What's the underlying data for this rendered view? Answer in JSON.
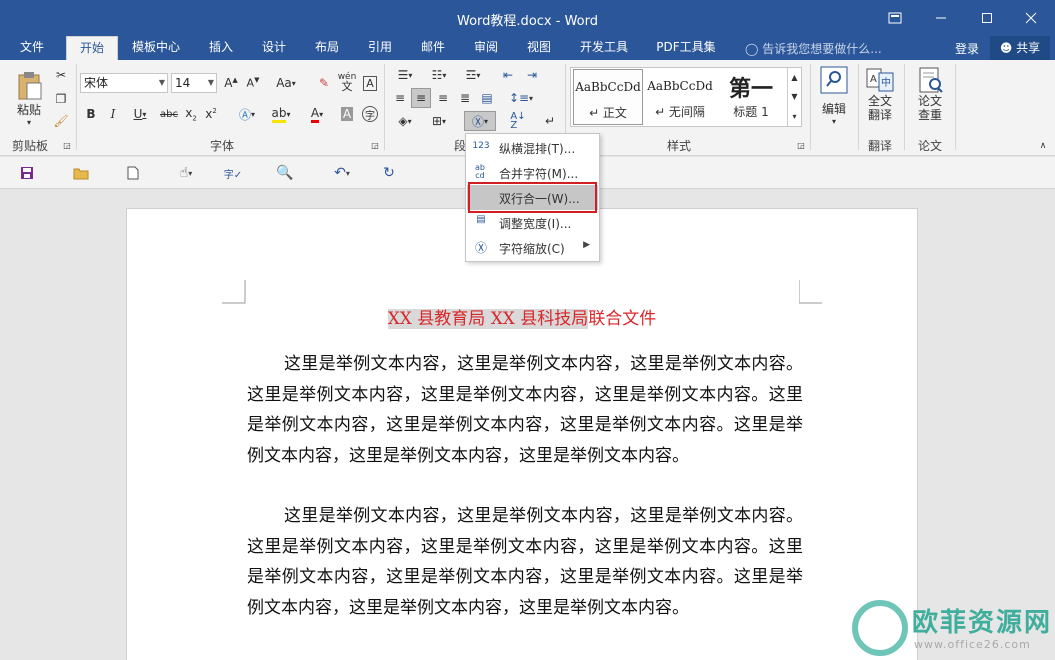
{
  "window": {
    "title": "Word教程.docx - Word"
  },
  "menu": {
    "tabs": [
      "文件",
      "开始",
      "模板中心",
      "插入",
      "设计",
      "布局",
      "引用",
      "邮件",
      "审阅",
      "视图",
      "开发工具",
      "PDF工具集"
    ],
    "active_tab": "开始",
    "tell_me": "告诉我您想要做什么...",
    "login": "登录",
    "share": "共享"
  },
  "ribbon": {
    "clipboard": {
      "label": "剪贴板",
      "paste": "粘贴"
    },
    "font": {
      "label": "字体",
      "name": "宋体",
      "size": "14",
      "aa": "Aa",
      "wen": "wén"
    },
    "paragraph": {
      "label": "段"
    },
    "styles": {
      "label": "样式",
      "items": [
        {
          "sample": "AaBbCcDd",
          "name": "↵ 正文"
        },
        {
          "sample": "AaBbCcDd",
          "name": "↵ 无间隔"
        },
        {
          "sample": "第一",
          "name": "标题 1"
        }
      ]
    },
    "editing": {
      "label": "编辑"
    },
    "translate": {
      "button": "全文翻译",
      "group": "翻译"
    },
    "paper": {
      "button": "论文查重",
      "group": "论文"
    }
  },
  "dropdown": {
    "items": [
      {
        "icon": "123",
        "label": "纵横混排(T)..."
      },
      {
        "icon": "ab cd",
        "label": "合并字符(M)..."
      },
      {
        "icon": "",
        "label": "双行合一(W)..."
      },
      {
        "icon": "",
        "label": "调整宽度(I)..."
      },
      {
        "icon": "",
        "label": "字符缩放(C)"
      }
    ],
    "highlighted_index": 2
  },
  "document": {
    "heading_highlighted": "XX 县教育局 XX 县科技局",
    "heading_rest": "联合文件",
    "paragraph1": "这里是举例文本内容，这里是举例文本内容，这里是举例文本内容。这里是举例文本内容，这里是举例文本内容，这里是举例文本内容。这里是举例文本内容，这里是举例文本内容，这里是举例文本内容。这里是举例文本内容，这里是举例文本内容，这里是举例文本内容。",
    "paragraph2": "这里是举例文本内容，这里是举例文本内容，这里是举例文本内容。这里是举例文本内容，这里是举例文本内容，这里是举例文本内容。这里是举例文本内容，这里是举例文本内容，这里是举例文本内容。这里是举例文本内容，这里是举例文本内容，这里是举例文本内容。"
  },
  "watermark": {
    "title": "欧菲资源网",
    "url": "www.office26.com"
  },
  "colors": {
    "word_blue": "#2b579a",
    "heading_red": "#d9262b",
    "highlight_box": "#d21e25",
    "watermark_green": "#3fae9d"
  }
}
